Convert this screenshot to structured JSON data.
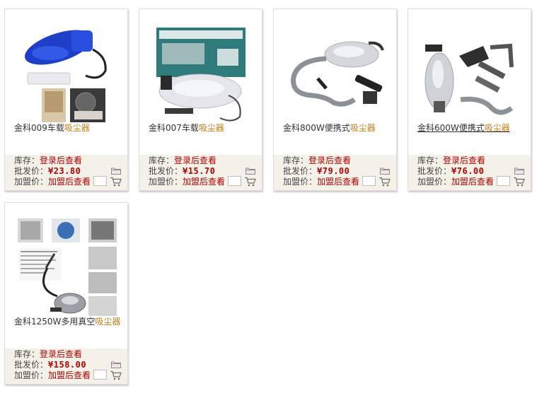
{
  "labels": {
    "stock": "库存：",
    "wholesale": "批发价：",
    "join": "加盟价：",
    "login_view": "登录后查看",
    "join_view": "加盟后查看"
  },
  "products": [
    {
      "name": "金科009车载",
      "keyword": "吸尘器",
      "price": "¥23.80"
    },
    {
      "name": "金科007车载",
      "keyword": "吸尘器",
      "price": "¥15.70"
    },
    {
      "name": "金科800W便携式",
      "keyword": "吸尘器",
      "price": "¥79.00"
    },
    {
      "name": "金科600W便携式",
      "keyword": "吸尘器",
      "price": "¥76.00"
    },
    {
      "name": "金科1250W多用真空",
      "keyword": "吸尘器",
      "price": "¥158.00"
    }
  ],
  "colors": {
    "keyword": "#c57d12",
    "price": "#b30000",
    "info_bg": "#f4f2e8"
  },
  "icons": [
    "folder-icon",
    "cart-icon"
  ]
}
